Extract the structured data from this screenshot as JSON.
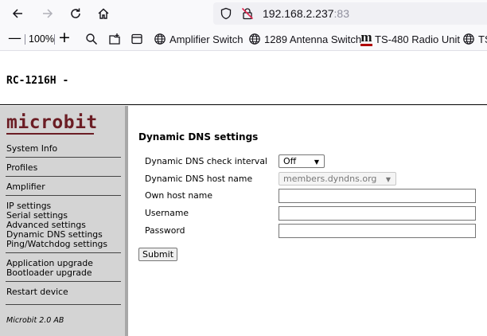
{
  "browser": {
    "url_host": "192.168.2.237",
    "url_port": ":83",
    "zoom": "100%",
    "bookmarks": [
      {
        "label": "Amplifier Switch",
        "icon": "globe-icon"
      },
      {
        "label": "1289 Antenna Switch",
        "icon": "globe-icon"
      },
      {
        "label": "TS-480 Radio Unit",
        "icon": "microbit-logo-icon"
      },
      {
        "label": "TS",
        "icon": "globe-icon"
      }
    ]
  },
  "page": {
    "title": "RC-1216H -"
  },
  "sidebar": {
    "logo": "microbit",
    "groups": [
      [
        "System Info"
      ],
      [
        "Profiles"
      ],
      [
        "Amplifier"
      ],
      [
        "IP settings",
        "Serial settings",
        "Advanced settings",
        "Dynamic DNS settings",
        "Ping/Watchdog settings"
      ],
      [
        "Application upgrade",
        "Bootloader upgrade"
      ],
      [
        "Restart device"
      ]
    ],
    "footer": "Microbit 2.0 AB"
  },
  "form": {
    "heading": "Dynamic DNS settings",
    "fields": [
      {
        "label": "Dynamic DNS check interval",
        "type": "select",
        "value": "Off"
      },
      {
        "label": "Dynamic DNS host name",
        "type": "select",
        "value": "members.dyndns.org",
        "disabled": true
      },
      {
        "label": "Own host name",
        "type": "text",
        "value": ""
      },
      {
        "label": "Username",
        "type": "text",
        "value": ""
      },
      {
        "label": "Password",
        "type": "password",
        "value": ""
      }
    ],
    "submit_label": "Submit"
  }
}
